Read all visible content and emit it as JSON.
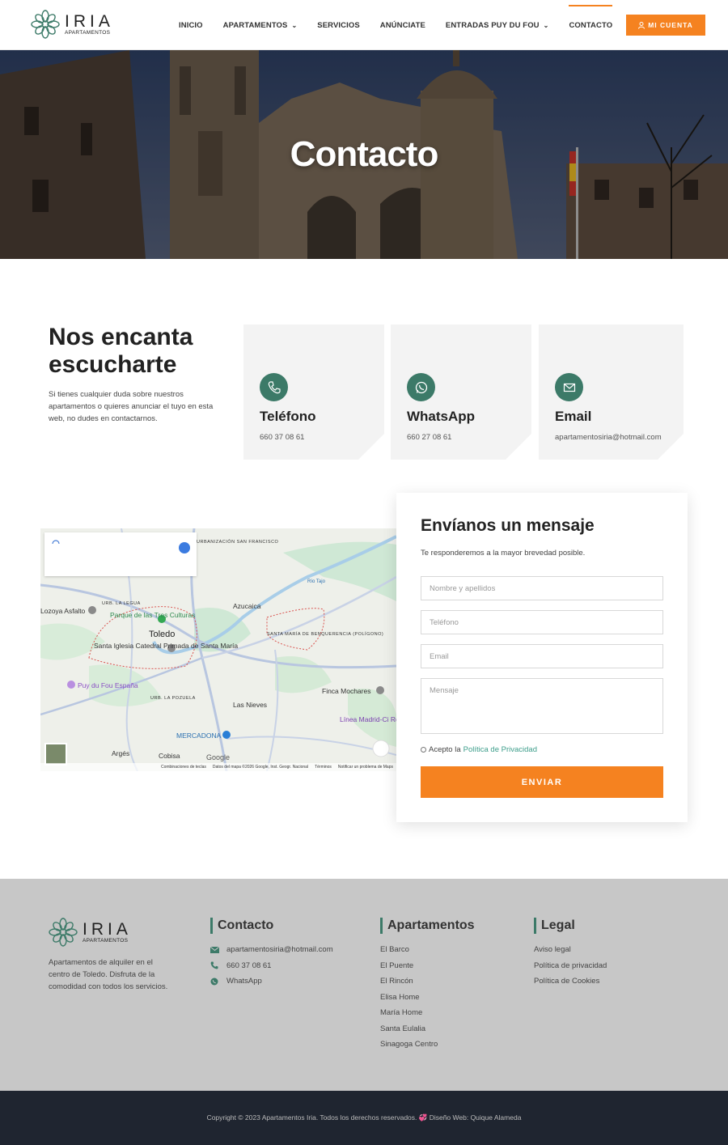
{
  "header": {
    "logo_name": "IRIA",
    "logo_sub": "APARTAMENTOS",
    "nav": [
      {
        "label": "INICIO"
      },
      {
        "label": "APARTAMENTOS"
      },
      {
        "label": "SERVICIOS"
      },
      {
        "label": "ANÚNCIATE"
      },
      {
        "label": "ENTRADAS PUY DU FOU"
      },
      {
        "label": "CONTACTO"
      }
    ],
    "account_label": "MI CUENTA",
    "accent_color": "#f58220"
  },
  "hero": {
    "title": "Contacto"
  },
  "intro": {
    "title": "Nos encanta escucharte",
    "text": "Si tienes cualquier duda sobre nuestros apartamentos o quieres anunciar el tuyo en esta web, no dudes en contactarnos."
  },
  "cards": [
    {
      "title": "Teléfono",
      "value": "660 37 08 61",
      "icon": "phone-icon"
    },
    {
      "title": "WhatsApp",
      "value": "660 27 08 61",
      "icon": "whatsapp-icon"
    },
    {
      "title": "Email",
      "value": "apartamentosiria@hotmail.com",
      "icon": "envelope-icon"
    }
  ],
  "map": {
    "labels": {
      "urbanizacion": "URBANIZACIÓN SAN FRANCISCO",
      "lozoya": "Lozoya Asfalto",
      "urb_legua": "URB. LA LEGUA",
      "parque": "Parque de las Tres Culturas",
      "azucaica": "Azucaica",
      "toledo": "Toledo",
      "catedral": "Santa Iglesia Catedral Primada de Santa María",
      "santa_maria": "SANTA MARÍA DE BENQUERENCIA (POLÍGONO)",
      "puy": "Puy du Fou España",
      "urb_pozuela": "URB. LA POZUELA",
      "finca": "Finca Mochares",
      "las_nieves": "Las Nieves",
      "linea": "Línea Madrid-Ci Real-Badajoz Anti",
      "mercadona": "MERCADONA",
      "arges": "Argés",
      "cobisa": "Cobisa",
      "rio_tajo": "Río Tajo",
      "google": "Google"
    },
    "footer": [
      "Combinaciones de teclas",
      "Datos del mapa ©2026 Google, Inst. Geogr. Nacional",
      "Términos",
      "Notificar un problema de Maps"
    ]
  },
  "form": {
    "title": "Envíanos un mensaje",
    "subtitle": "Te responderemos a la mayor brevedad posible.",
    "name_placeholder": "Nombre y apellidos",
    "phone_placeholder": "Teléfono",
    "email_placeholder": "Email",
    "message_placeholder": "Mensaje",
    "privacy_prefix": "Acepto la",
    "privacy_link": "Política de Privacidad",
    "submit_label": "ENVIAR"
  },
  "footer": {
    "logo_name": "IRIA",
    "logo_sub": "APARTAMENTOS",
    "description": "Apartamentos de alquiler en el centro de Toledo. Disfruta de la comodidad con todos los servicios.",
    "contact": {
      "title": "Contacto",
      "items": [
        {
          "label": "apartamentosiria@hotmail.com",
          "icon": "envelope-icon"
        },
        {
          "label": "660 37 08 61",
          "icon": "phone-icon"
        },
        {
          "label": "WhatsApp",
          "icon": "whatsapp-icon"
        }
      ]
    },
    "apartments": {
      "title": "Apartamentos",
      "items": [
        "El Barco",
        "El Puente",
        "El Rincón",
        "Elisa Home",
        "María Home",
        "Santa Eulalia",
        "Sinagoga Centro"
      ]
    },
    "legal": {
      "title": "Legal",
      "items": [
        "Aviso legal",
        "Política de privacidad",
        "Política de Cookies"
      ]
    },
    "brand_color": "#3c7a68"
  },
  "copyright": "Copyright © 2023 Apartamentos Iria. Todos los derechos reservados. 💞 Diseño Web: Quique Alameda"
}
